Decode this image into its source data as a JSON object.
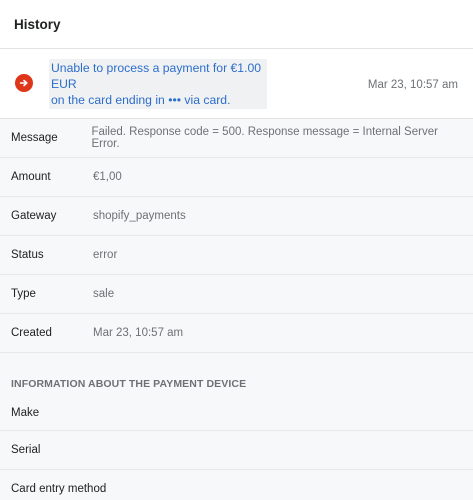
{
  "header": {
    "title": "History"
  },
  "event": {
    "icon": "arrow-right-icon",
    "line1": "Unable to process a payment for €1.00 EUR",
    "line2": "on the card ending in ••• via card.",
    "time": "Mar 23, 10:57 am",
    "icon_color": "#de3618",
    "link_color": "#2c6ecb"
  },
  "details": [
    {
      "label": "Message",
      "value": "Failed. Response code = 500. Response message = Internal Server Error."
    },
    {
      "label": "Amount",
      "value": "€1,00"
    },
    {
      "label": "Gateway",
      "value": "shopify_payments"
    },
    {
      "label": "Status",
      "value": "error"
    },
    {
      "label": "Type",
      "value": "sale"
    },
    {
      "label": "Created",
      "value": "Mar 23, 10:57 am"
    }
  ],
  "device": {
    "title": "INFORMATION ABOUT THE PAYMENT DEVICE",
    "fields": [
      "Make",
      "Serial",
      "Card entry method"
    ]
  }
}
